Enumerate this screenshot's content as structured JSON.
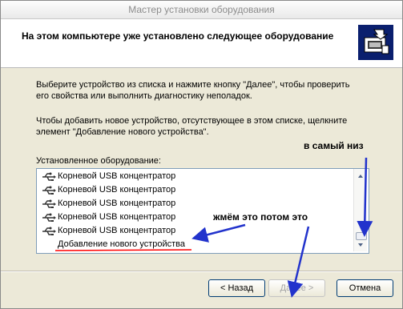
{
  "window": {
    "title": "Мастер установки оборудования"
  },
  "header": {
    "title": "На этом компьютере уже установлено следующее оборудование"
  },
  "instructions": {
    "line1": "Выберите устройство из списка и нажмите кнопку \"Далее\", чтобы проверить",
    "line2": "его свойства или выполнить диагностику неполадок.",
    "line3": "Чтобы добавить новое устройство, отсутствующее в этом списке, щелкните",
    "line4": "элемент \"Добавление нового устройства\"."
  },
  "list": {
    "label": "Установленное оборудование:",
    "items": [
      {
        "label": "Корневой USB концентратор",
        "icon": "usb-icon"
      },
      {
        "label": "Корневой USB концентратор",
        "icon": "usb-icon"
      },
      {
        "label": "Корневой USB концентратор",
        "icon": "usb-icon"
      },
      {
        "label": "Корневой USB концентратор",
        "icon": "usb-icon"
      },
      {
        "label": "Корневой USB концентратор",
        "icon": "usb-icon"
      },
      {
        "label": "Добавление нового устройства",
        "icon": ""
      }
    ]
  },
  "buttons": {
    "back": "< Назад",
    "next": "Далее >",
    "cancel": "Отмена"
  },
  "annotations": {
    "scroll_hint": "в самый низ",
    "click_hint": "жмём это потом это",
    "arrow_color": "#2233cc",
    "underline_color": "#ff0000"
  },
  "colors": {
    "header_bg": "#ffffff",
    "window_bg": "#ece9d8",
    "list_border": "#7f9db9"
  }
}
